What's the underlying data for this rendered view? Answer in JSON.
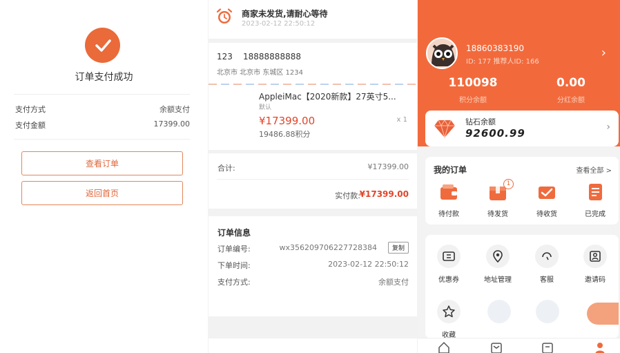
{
  "colors": {
    "accent": "#ea6a3a",
    "price": "#e0452a",
    "hero_bg": "#f26a3c"
  },
  "success_panel": {
    "title": "订单支付成功",
    "rows": [
      {
        "label": "支付方式",
        "value": "余额支付"
      },
      {
        "label": "支付金额",
        "value": "17399.00"
      }
    ],
    "view_order_button": "查看订单",
    "back_home_button": "返回首页"
  },
  "order_panel": {
    "status": {
      "icon": "alarm-clock-icon",
      "title": "商家未发货,请耐心等待",
      "time": "2023-02-12  22:50:12"
    },
    "address": {
      "name": "123",
      "phone": "18888888888",
      "detail": "北京市 北京市 东城区 1234"
    },
    "goods": {
      "name": "AppleiMac【2020新款】27英寸5...",
      "spec": "默认",
      "price": "¥17399.00",
      "points": "19486.88积分",
      "qty": "x 1"
    },
    "totals": {
      "sum_label": "合计:",
      "sum_value": "¥17399.00",
      "paid_label": "实付款:",
      "paid_value": "¥17399.00"
    },
    "info": {
      "title": "订单信息",
      "order_no_label": "订单编号:",
      "order_no": "wx356209706227728384",
      "copy_label": "复制",
      "time_label": "下单时间:",
      "time": "2023-02-12 22:50:12",
      "pay_label": "支付方式:",
      "pay": "余额支付"
    }
  },
  "member_panel": {
    "user": {
      "phone": "18860383190",
      "ids": "ID: 177   推荐人ID: 166"
    },
    "stats": [
      {
        "value": "110098",
        "label": "积分余额"
      },
      {
        "value": "0.00",
        "label": "分红余额"
      }
    ],
    "wallet": {
      "label": "钻石余额",
      "value": "92600.99",
      "icon": "diamond-icon"
    },
    "orders": {
      "title": "我的订单",
      "view_all": "查看全部 >",
      "items": [
        {
          "label": "待付款",
          "icon": "wallet-icon"
        },
        {
          "label": "待发货",
          "icon": "box-icon",
          "badge": "1"
        },
        {
          "label": "待收货",
          "icon": "truck-icon"
        },
        {
          "label": "已完成",
          "icon": "document-check-icon"
        }
      ]
    },
    "services": {
      "items": [
        {
          "label": "优惠券",
          "icon": "coupon-icon"
        },
        {
          "label": "地址管理",
          "icon": "location-pin-icon"
        },
        {
          "label": "客服",
          "icon": "headset-icon"
        },
        {
          "label": "邀请码",
          "icon": "invite-icon"
        },
        {
          "label": "收藏",
          "icon": "star-icon"
        }
      ]
    }
  }
}
